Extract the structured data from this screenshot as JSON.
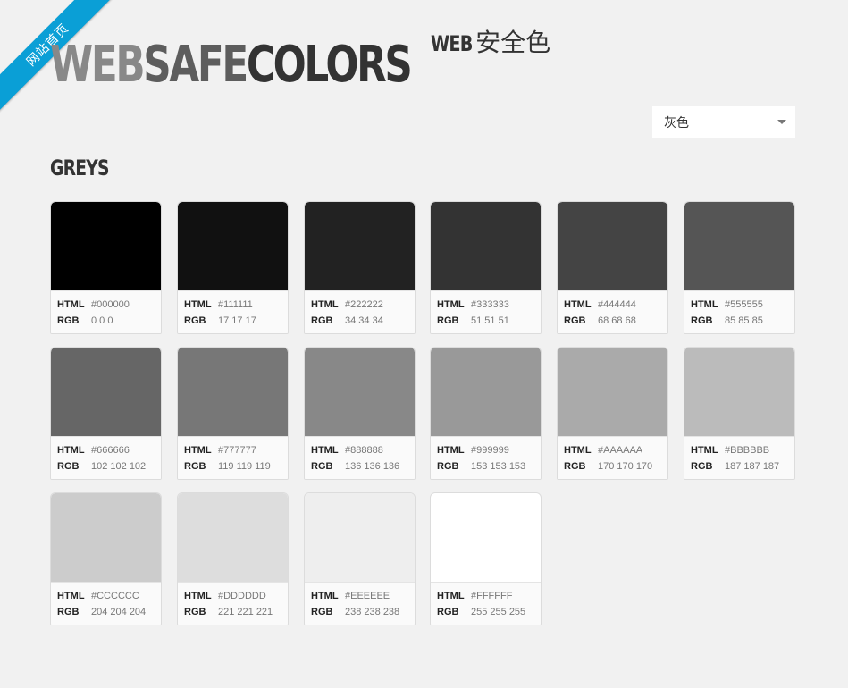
{
  "ribbon": {
    "label": "网站首页"
  },
  "logo": {
    "part1": "WEB",
    "part2": "SAFE",
    "part3": "COLORS"
  },
  "subtitle": {
    "part1": "WEB",
    "part2": "安全色"
  },
  "select": {
    "value": "灰色"
  },
  "section": {
    "title": "GREYS"
  },
  "labels": {
    "html": "HTML",
    "rgb": "RGB"
  },
  "colors": [
    {
      "hex": "#000000",
      "rgb": "0 0 0"
    },
    {
      "hex": "#111111",
      "rgb": "17 17 17"
    },
    {
      "hex": "#222222",
      "rgb": "34 34 34"
    },
    {
      "hex": "#333333",
      "rgb": "51 51 51"
    },
    {
      "hex": "#444444",
      "rgb": "68 68 68"
    },
    {
      "hex": "#555555",
      "rgb": "85 85 85"
    },
    {
      "hex": "#666666",
      "rgb": "102 102 102"
    },
    {
      "hex": "#777777",
      "rgb": "119 119 119"
    },
    {
      "hex": "#888888",
      "rgb": "136 136 136"
    },
    {
      "hex": "#999999",
      "rgb": "153 153 153"
    },
    {
      "hex": "#AAAAAA",
      "rgb": "170 170 170"
    },
    {
      "hex": "#BBBBBB",
      "rgb": "187 187 187"
    },
    {
      "hex": "#CCCCCC",
      "rgb": "204 204 204"
    },
    {
      "hex": "#DDDDDD",
      "rgb": "221 221 221"
    },
    {
      "hex": "#EEEEEE",
      "rgb": "238 238 238"
    },
    {
      "hex": "#FFFFFF",
      "rgb": "255 255 255"
    }
  ]
}
